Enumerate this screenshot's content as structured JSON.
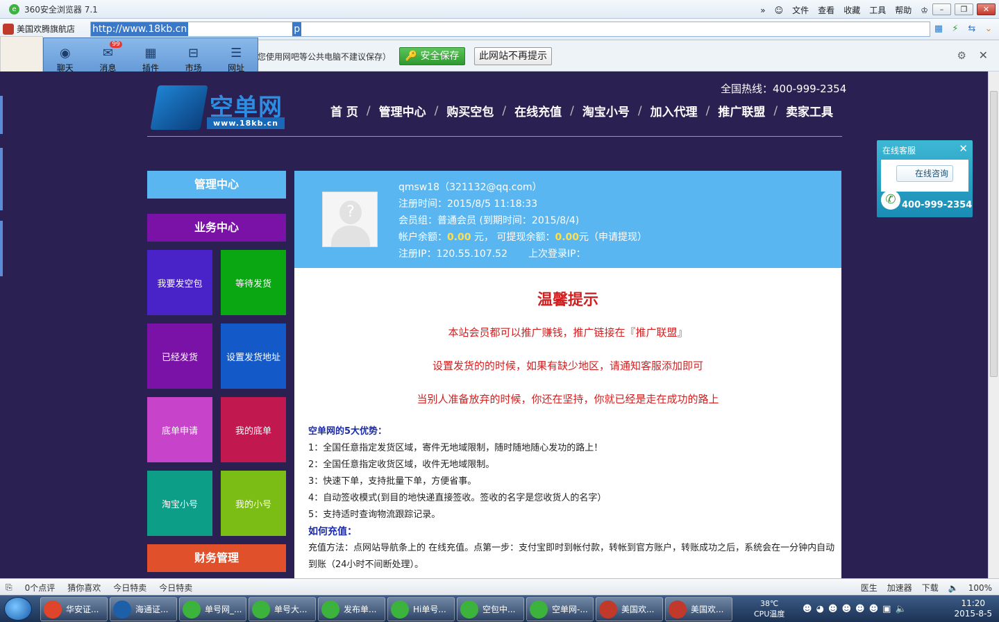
{
  "browser": {
    "title": "360安全浏览器 7.1",
    "menus": [
      "文件",
      "查看",
      "收藏",
      "工具",
      "帮助"
    ],
    "tab_label": "美国欢腾旗航店",
    "url": "http://www.18kb.cn",
    "url_tail": "p"
  },
  "password_bar": {
    "message": "您使用网吧等公共电脑不建议保存）",
    "save_label": "安全保存",
    "no_more_label": "此网站不再提示"
  },
  "mini_panel": {
    "items": [
      {
        "label": "聊天",
        "icon": "chat-icon"
      },
      {
        "label": "消息",
        "icon": "message-icon",
        "badge": "99"
      },
      {
        "label": "插件",
        "icon": "plugin-icon"
      },
      {
        "label": "市场",
        "icon": "market-icon"
      },
      {
        "label": "网址",
        "icon": "list-icon"
      }
    ]
  },
  "site": {
    "hotline": "全国热线：400-999-2354",
    "logo_cn": "空单网",
    "logo_en": "www.18kb.cn",
    "nav": [
      "首 页",
      "管理中心",
      "购买空包",
      "在线充值",
      "淘宝小号",
      "加入代理",
      "推广联盟",
      "卖家工具"
    ]
  },
  "sidebar": {
    "header1": "管理中心",
    "header2": "业务中心",
    "tiles": [
      {
        "label": "我要发空包",
        "color": "#4a23c8"
      },
      {
        "label": "等待发货",
        "color": "#0aa713"
      },
      {
        "label": "已经发货",
        "color": "#7a12a8"
      },
      {
        "label": "设置发货地址",
        "color": "#1359c8"
      },
      {
        "label": "底单申请",
        "color": "#c743c9"
      },
      {
        "label": "我的底单",
        "color": "#c0184f"
      },
      {
        "label": "淘宝小号",
        "color": "#0d9e88"
      },
      {
        "label": "我的小号",
        "color": "#7bbd14"
      }
    ],
    "header3": "财务管理"
  },
  "user": {
    "name_line": "qmsw18（321132@qq.com）",
    "reg_time": "注册时间：2015/8/5 11:18:33",
    "group": "会员组：普通会员 (到期时间：2015/8/4)",
    "balance_prefix": "帐户余额：",
    "balance": "0.00",
    "balance_mid": " 元， 可提现余额：",
    "withdrawable": "0.00",
    "balance_suffix": "元（申请提现）",
    "reg_ip": "注册IP：120.55.107.52",
    "last_ip": "上次登录IP："
  },
  "tips": {
    "title": "温馨提示",
    "line1": "本站会员都可以推广赚钱，推广链接在『推广联盟』",
    "line2": "设置发货的的时候，如果有缺少地区，请通知客服添加即可",
    "line3": "当别人准备放弃的时候，你还在坚持，你就已经是走在成功的路上"
  },
  "advantages": {
    "heading": "空单网的5大优势：",
    "items": [
      "1：全国任意指定发货区域，寄件无地域限制，随时随地随心发功的路上！",
      "2：全国任意指定收货区域，收件无地域限制。",
      "3：快速下单，支持批量下单，方便省事。",
      "4：自动签收模式(到目的地快递直接签收。签收的名字是您收货人的名字）",
      "5：支持适时查询物流跟踪记录。"
    ],
    "recharge_heading": "如何充值：",
    "recharge_text": "充值方法：点网站导航条上的 在线充值。点第一步：支付宝即时到帐付款，转帐到官方账户，转账成功之后，系统会在一分钟内自动到账（24小时不间断处理）。"
  },
  "cs_widget": {
    "title": "在线客服",
    "consult": "在线咨询",
    "phone": "400-999-2354"
  },
  "statusbar": {
    "left": [
      "0个点评",
      "猜你喜欢",
      "今日特卖",
      "今日特卖"
    ],
    "right": [
      "医生",
      "加速器",
      "下载"
    ],
    "zoom": "100%"
  },
  "taskbar": {
    "tasks": [
      {
        "label": "华安证...",
        "color": "#e0442a"
      },
      {
        "label": "海通证...",
        "color": "#1d5fa8"
      },
      {
        "label": "单号网_...",
        "color": "#3cb33c"
      },
      {
        "label": "单号大...",
        "color": "#3cb33c"
      },
      {
        "label": "发布单...",
        "color": "#3cb33c"
      },
      {
        "label": "Hi单号...",
        "color": "#3cb33c"
      },
      {
        "label": "空包中...",
        "color": "#3cb33c"
      },
      {
        "label": "空单网-...",
        "color": "#3cb33c"
      },
      {
        "label": "美国欢...",
        "color": "#c0392b"
      },
      {
        "label": "美国欢...",
        "color": "#c0392b"
      }
    ],
    "temp": "38℃",
    "cpu": "CPU温度",
    "time": "11:20",
    "date": "2015-8-5"
  }
}
